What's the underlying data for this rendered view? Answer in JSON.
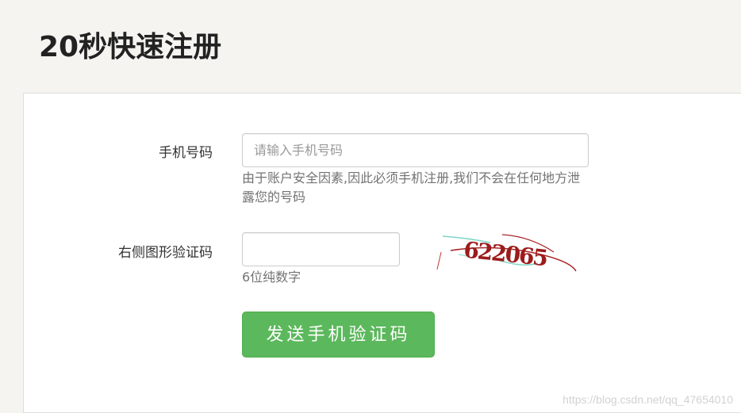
{
  "page": {
    "title": "20秒快速注册"
  },
  "form": {
    "phone": {
      "label": "手机号码",
      "value": "",
      "placeholder": "请输入手机号码",
      "help": "由于账户安全因素,因此必须手机注册,我们不会在任何地方泄露您的号码"
    },
    "captcha": {
      "label": "右侧图形验证码",
      "value": "",
      "placeholder": "",
      "help": "6位纯数字",
      "image_text": "622065"
    },
    "send_button_label": "发送手机验证码"
  },
  "watermark": "https://blog.csdn.net/qq_47654010",
  "colors": {
    "accent_green": "#5cb85c",
    "captcha_text": "#9b1c1c"
  }
}
